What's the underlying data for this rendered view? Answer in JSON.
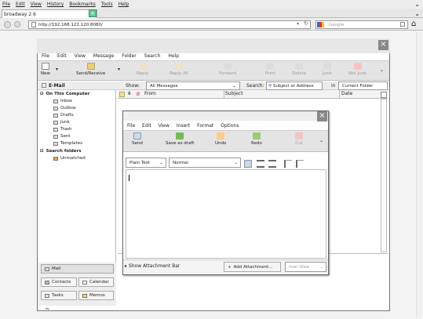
{
  "browser": {
    "menu": [
      "File",
      "Edit",
      "View",
      "History",
      "Bookmarks",
      "Tools",
      "Help"
    ],
    "tab_title": "broadway 2.6",
    "new_tab": "+",
    "url": "http://192.168.122.120:8080/",
    "search_placeholder": "Google",
    "chevron": "⌄"
  },
  "thunderbird": {
    "menu": [
      "File",
      "Edit",
      "View",
      "Message",
      "Folder",
      "Search",
      "Help"
    ],
    "toolbar": {
      "new": "New",
      "send_receive": "Send/Receive",
      "reply": "Reply",
      "reply_all": "Reply All",
      "forward": "Forward",
      "print": "Print",
      "delete": "Delete",
      "junk": "Junk",
      "not_junk": "Not Junk"
    },
    "email_label": "E-Mail",
    "show_label": "Show:",
    "show_value": "All Messages",
    "search_label": "Search:",
    "search_value": "Subject or Address",
    "in_label": "in",
    "in_value": "Current Folder",
    "columns": {
      "from": "From",
      "subject": "Subject",
      "date": "Date"
    },
    "folders": {
      "root": "On This Computer",
      "items": [
        "Inbox",
        "Outbox",
        "Drafts",
        "Junk",
        "Trash",
        "Sent",
        "Templates"
      ],
      "search_root": "Search folders",
      "search_items": [
        "Unmatched"
      ]
    },
    "pane_buttons": {
      "mail": "Mail",
      "contacts": "Contacts",
      "calendar": "Calendar",
      "tasks": "Tasks",
      "memos": "Memos"
    },
    "close": "×"
  },
  "composer": {
    "menu": [
      "File",
      "Edit",
      "View",
      "Insert",
      "Format",
      "Options"
    ],
    "toolbar": {
      "send": "Send",
      "save_draft": "Save as draft",
      "undo": "Undo",
      "redo": "Redo",
      "cut": "Cut"
    },
    "format": "Plain Text",
    "paragraph": "Normal",
    "show_attachment": "Show Attachment Bar",
    "add_attachment": "Add Attachment...",
    "icon_view": "Icon View",
    "close": "×"
  }
}
